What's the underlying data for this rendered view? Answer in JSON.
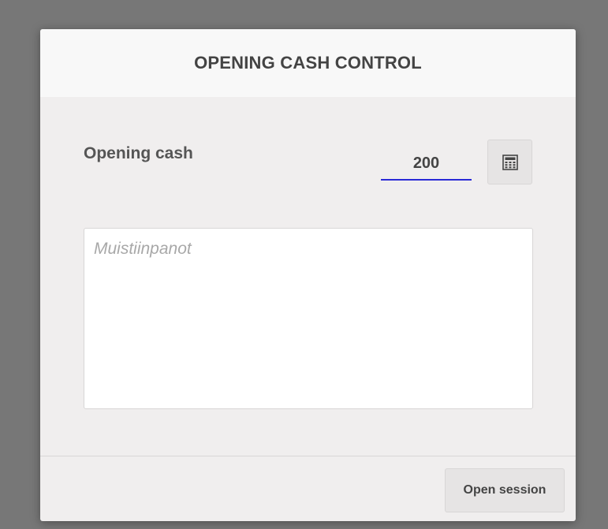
{
  "dialog": {
    "title": "OPENING CASH CONTROL",
    "opening_cash_label": "Opening cash",
    "opening_cash_value": "200",
    "calculator_icon": "calculator-icon",
    "notes_placeholder": "Muistiinpanot",
    "notes_value": "",
    "open_session_label": "Open session"
  },
  "colors": {
    "backdrop": "#777777",
    "dialog_bg": "#f0eeee",
    "header_bg": "#f8f8f8",
    "input_underline": "#2a2ad6",
    "button_bg": "#e6e4e4",
    "text": "#444444"
  }
}
